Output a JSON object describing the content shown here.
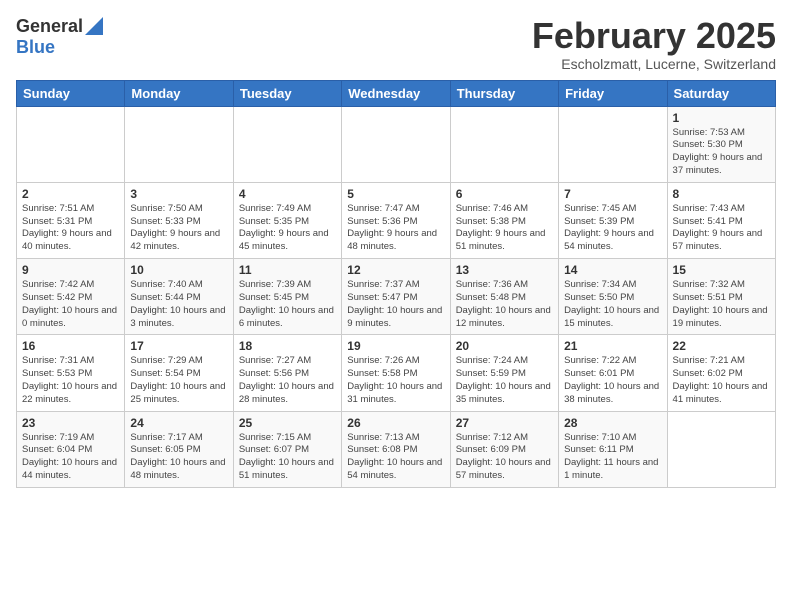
{
  "logo": {
    "general": "General",
    "blue": "Blue"
  },
  "header": {
    "month": "February 2025",
    "location": "Escholzmatt, Lucerne, Switzerland"
  },
  "weekdays": [
    "Sunday",
    "Monday",
    "Tuesday",
    "Wednesday",
    "Thursday",
    "Friday",
    "Saturday"
  ],
  "weeks": [
    [
      {
        "day": "",
        "info": ""
      },
      {
        "day": "",
        "info": ""
      },
      {
        "day": "",
        "info": ""
      },
      {
        "day": "",
        "info": ""
      },
      {
        "day": "",
        "info": ""
      },
      {
        "day": "",
        "info": ""
      },
      {
        "day": "1",
        "info": "Sunrise: 7:53 AM\nSunset: 5:30 PM\nDaylight: 9 hours and 37 minutes."
      }
    ],
    [
      {
        "day": "2",
        "info": "Sunrise: 7:51 AM\nSunset: 5:31 PM\nDaylight: 9 hours and 40 minutes."
      },
      {
        "day": "3",
        "info": "Sunrise: 7:50 AM\nSunset: 5:33 PM\nDaylight: 9 hours and 42 minutes."
      },
      {
        "day": "4",
        "info": "Sunrise: 7:49 AM\nSunset: 5:35 PM\nDaylight: 9 hours and 45 minutes."
      },
      {
        "day": "5",
        "info": "Sunrise: 7:47 AM\nSunset: 5:36 PM\nDaylight: 9 hours and 48 minutes."
      },
      {
        "day": "6",
        "info": "Sunrise: 7:46 AM\nSunset: 5:38 PM\nDaylight: 9 hours and 51 minutes."
      },
      {
        "day": "7",
        "info": "Sunrise: 7:45 AM\nSunset: 5:39 PM\nDaylight: 9 hours and 54 minutes."
      },
      {
        "day": "8",
        "info": "Sunrise: 7:43 AM\nSunset: 5:41 PM\nDaylight: 9 hours and 57 minutes."
      }
    ],
    [
      {
        "day": "9",
        "info": "Sunrise: 7:42 AM\nSunset: 5:42 PM\nDaylight: 10 hours and 0 minutes."
      },
      {
        "day": "10",
        "info": "Sunrise: 7:40 AM\nSunset: 5:44 PM\nDaylight: 10 hours and 3 minutes."
      },
      {
        "day": "11",
        "info": "Sunrise: 7:39 AM\nSunset: 5:45 PM\nDaylight: 10 hours and 6 minutes."
      },
      {
        "day": "12",
        "info": "Sunrise: 7:37 AM\nSunset: 5:47 PM\nDaylight: 10 hours and 9 minutes."
      },
      {
        "day": "13",
        "info": "Sunrise: 7:36 AM\nSunset: 5:48 PM\nDaylight: 10 hours and 12 minutes."
      },
      {
        "day": "14",
        "info": "Sunrise: 7:34 AM\nSunset: 5:50 PM\nDaylight: 10 hours and 15 minutes."
      },
      {
        "day": "15",
        "info": "Sunrise: 7:32 AM\nSunset: 5:51 PM\nDaylight: 10 hours and 19 minutes."
      }
    ],
    [
      {
        "day": "16",
        "info": "Sunrise: 7:31 AM\nSunset: 5:53 PM\nDaylight: 10 hours and 22 minutes."
      },
      {
        "day": "17",
        "info": "Sunrise: 7:29 AM\nSunset: 5:54 PM\nDaylight: 10 hours and 25 minutes."
      },
      {
        "day": "18",
        "info": "Sunrise: 7:27 AM\nSunset: 5:56 PM\nDaylight: 10 hours and 28 minutes."
      },
      {
        "day": "19",
        "info": "Sunrise: 7:26 AM\nSunset: 5:58 PM\nDaylight: 10 hours and 31 minutes."
      },
      {
        "day": "20",
        "info": "Sunrise: 7:24 AM\nSunset: 5:59 PM\nDaylight: 10 hours and 35 minutes."
      },
      {
        "day": "21",
        "info": "Sunrise: 7:22 AM\nSunset: 6:01 PM\nDaylight: 10 hours and 38 minutes."
      },
      {
        "day": "22",
        "info": "Sunrise: 7:21 AM\nSunset: 6:02 PM\nDaylight: 10 hours and 41 minutes."
      }
    ],
    [
      {
        "day": "23",
        "info": "Sunrise: 7:19 AM\nSunset: 6:04 PM\nDaylight: 10 hours and 44 minutes."
      },
      {
        "day": "24",
        "info": "Sunrise: 7:17 AM\nSunset: 6:05 PM\nDaylight: 10 hours and 48 minutes."
      },
      {
        "day": "25",
        "info": "Sunrise: 7:15 AM\nSunset: 6:07 PM\nDaylight: 10 hours and 51 minutes."
      },
      {
        "day": "26",
        "info": "Sunrise: 7:13 AM\nSunset: 6:08 PM\nDaylight: 10 hours and 54 minutes."
      },
      {
        "day": "27",
        "info": "Sunrise: 7:12 AM\nSunset: 6:09 PM\nDaylight: 10 hours and 57 minutes."
      },
      {
        "day": "28",
        "info": "Sunrise: 7:10 AM\nSunset: 6:11 PM\nDaylight: 11 hours and 1 minute."
      },
      {
        "day": "",
        "info": ""
      }
    ]
  ]
}
